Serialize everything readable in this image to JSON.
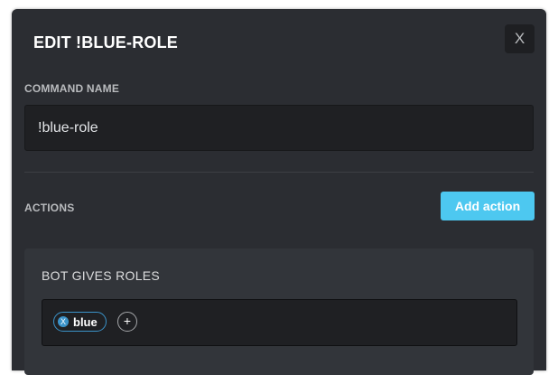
{
  "modal": {
    "title": "EDIT !BLUE-ROLE",
    "close_label": "X"
  },
  "command": {
    "label": "COMMAND NAME",
    "value": "!blue-role"
  },
  "actions": {
    "label": "ACTIONS",
    "add_button_label": "Add action",
    "items": [
      {
        "title": "BOT GIVES ROLES",
        "roles": [
          {
            "name": "blue",
            "remove_label": "X"
          }
        ],
        "add_role_label": "+"
      }
    ]
  },
  "colors": {
    "modal_bg": "#2b2d32",
    "accent": "#4dc8f0",
    "chip_border": "#3b93c9"
  }
}
